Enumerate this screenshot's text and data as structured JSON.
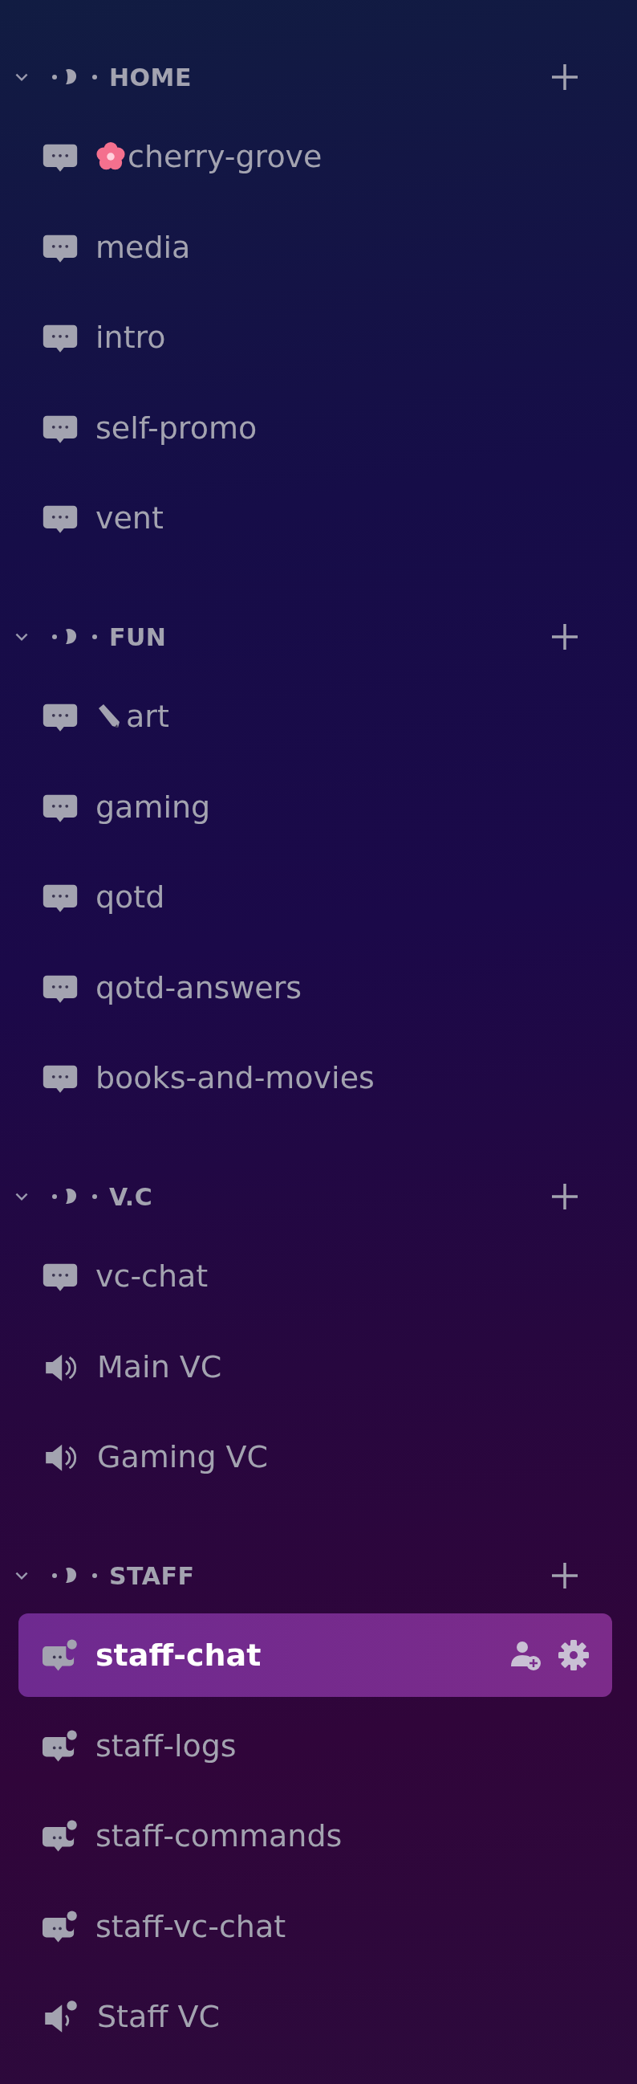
{
  "categories": [
    {
      "name": "HOME",
      "expanded": true,
      "channels": [
        {
          "kind": "text",
          "prefix": {
            "kind": "flower"
          },
          "name": "cherry-grove",
          "selected": false
        },
        {
          "kind": "text",
          "name": "media",
          "selected": false
        },
        {
          "kind": "text",
          "name": "intro",
          "selected": false
        },
        {
          "kind": "text",
          "name": "self-promo",
          "selected": false
        },
        {
          "kind": "text",
          "name": "vent",
          "selected": false
        }
      ]
    },
    {
      "name": "FUN",
      "expanded": true,
      "channels": [
        {
          "kind": "text",
          "prefix": {
            "kind": "pencil"
          },
          "name": "art",
          "selected": false
        },
        {
          "kind": "text",
          "name": "gaming",
          "selected": false
        },
        {
          "kind": "text",
          "name": "qotd",
          "selected": false
        },
        {
          "kind": "text",
          "name": "qotd-answers",
          "selected": false
        },
        {
          "kind": "text",
          "name": "books-and-movies",
          "selected": false
        }
      ]
    },
    {
      "name": "V.C",
      "expanded": true,
      "channels": [
        {
          "kind": "text",
          "name": "vc-chat",
          "selected": false
        },
        {
          "kind": "voice",
          "name": "Main VC",
          "selected": false
        },
        {
          "kind": "voice",
          "name": "Gaming VC",
          "selected": false
        }
      ]
    },
    {
      "name": "STAFF",
      "expanded": true,
      "channels": [
        {
          "kind": "text-private",
          "name": "staff-chat",
          "selected": true
        },
        {
          "kind": "text-private",
          "name": "staff-logs",
          "selected": false
        },
        {
          "kind": "text-private",
          "name": "staff-commands",
          "selected": false
        },
        {
          "kind": "text-private",
          "name": "staff-vc-chat",
          "selected": false
        },
        {
          "kind": "voice-private",
          "name": "Staff VC",
          "selected": false
        }
      ]
    }
  ]
}
